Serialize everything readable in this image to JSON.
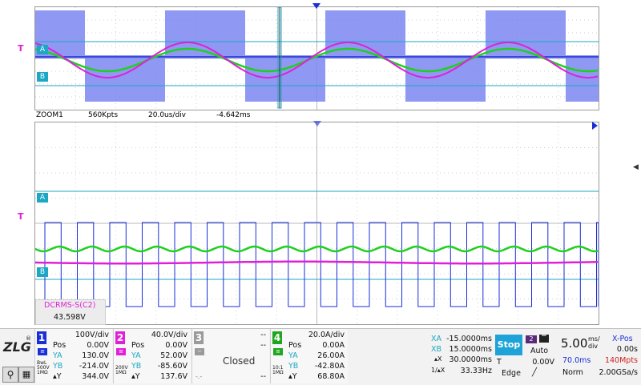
{
  "zoom": {
    "label": "ZOOM1",
    "points": "560Kpts",
    "timebase": "20.0us/div",
    "offset": "-4.642ms"
  },
  "cursor_labels": {
    "a": "A",
    "b": "B",
    "trigger": "T"
  },
  "measurement": {
    "name": "DCRMS-S(C2)",
    "value": "43.598V"
  },
  "channels": [
    {
      "num": "1",
      "color": "#1a2fd8",
      "scale": "100V/div",
      "pos_label": "Pos",
      "pos": "0.00V",
      "ya_label": "YA",
      "ya": "130.0V",
      "yb_label": "YB",
      "yb": "-214.0V",
      "dy_label": "▴Y",
      "dy": "344.0V",
      "coupling": "BwL 500V 1MΩ"
    },
    {
      "num": "2",
      "color": "#e020d8",
      "scale": "40.0V/div",
      "pos_label": "Pos",
      "pos": "0.00V",
      "ya_label": "YA",
      "ya": "52.00V",
      "yb_label": "YB",
      "yb": "-85.60V",
      "dy_label": "▴Y",
      "dy": "137.6V",
      "coupling": "200V 1MΩ"
    },
    {
      "num": "3",
      "color": "#9a9a9a",
      "scale": "--",
      "pos": "--",
      "state": "Closed",
      "dy": "--"
    },
    {
      "num": "4",
      "color": "#1fa61f",
      "scale": "20.0A/div",
      "pos_label": "Pos",
      "pos": "0.00A",
      "ya_label": "YA",
      "ya": "26.00A",
      "yb_label": "YB",
      "yb": "-42.80A",
      "dy_label": "▴Y",
      "dy": "68.80A",
      "coupling": "10:1 1MΩ"
    }
  ],
  "cursors": {
    "xa_label": "XA",
    "xa": "-15.0000ms",
    "xb_label": "XB",
    "xb": "15.0000ms",
    "dx_label": "▴X",
    "dx": "30.0000ms",
    "inv_label": "1/▴X",
    "freq": "33.33Hz"
  },
  "run_state": "Stop",
  "trigger": {
    "source": "2",
    "mode": "Auto",
    "t_label": "T",
    "level": "0.00V",
    "type": "Edge"
  },
  "timebase": {
    "value": "5.00",
    "unit_top": "ms/",
    "unit_bottom": "div",
    "delay": "70.0ms",
    "memory": "140Mpts",
    "acq_mode": "Norm",
    "sample_rate": "2.00GSa/s"
  },
  "xpos": {
    "label": "X-Pos",
    "value": "0.00s"
  },
  "logo": "ZLG",
  "colors": {
    "ch1": "#1a2fd8",
    "ch2": "#e020d8",
    "ch4": "#1fa61f",
    "cursor": "#1ca7c4",
    "grid": "#c8c8c8"
  }
}
